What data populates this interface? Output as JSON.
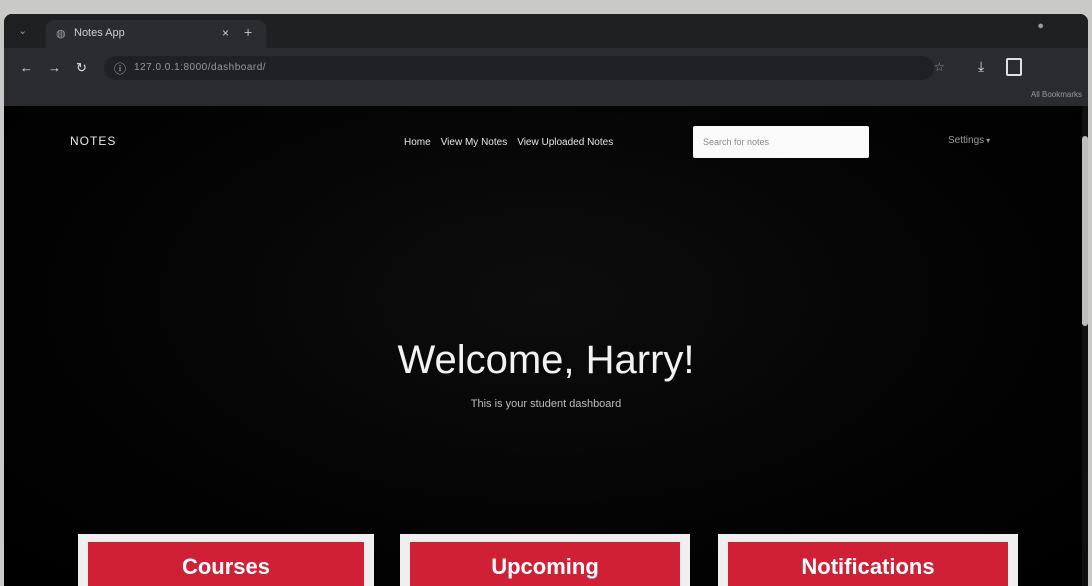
{
  "browser": {
    "tab_title": "Notes App",
    "tab_close": "×",
    "new_tab": "+",
    "url": "127.0.0.1:8000/dashboard/",
    "all_bookmarks": "All Bookmarks",
    "icons": [
      "back-icon",
      "forward-icon",
      "reload-icon",
      "site-info-icon",
      "star-icon",
      "download-icon",
      "side-panel-icon"
    ]
  },
  "nav": {
    "brand": "NOTES",
    "links": [
      "Home",
      "View My Notes",
      "View Uploaded Notes"
    ],
    "search_placeholder": "Search for notes",
    "settings": "Settings"
  },
  "hero": {
    "title": "Welcome, Harry!",
    "subtitle": "This is your student dashboard"
  },
  "cards": [
    "Courses",
    "Upcoming",
    "Notifications"
  ],
  "colors": {
    "page_background": "#000000",
    "card_red": "#cf2035",
    "card_border": "#efefef",
    "text_white": "#f2f2f2"
  }
}
